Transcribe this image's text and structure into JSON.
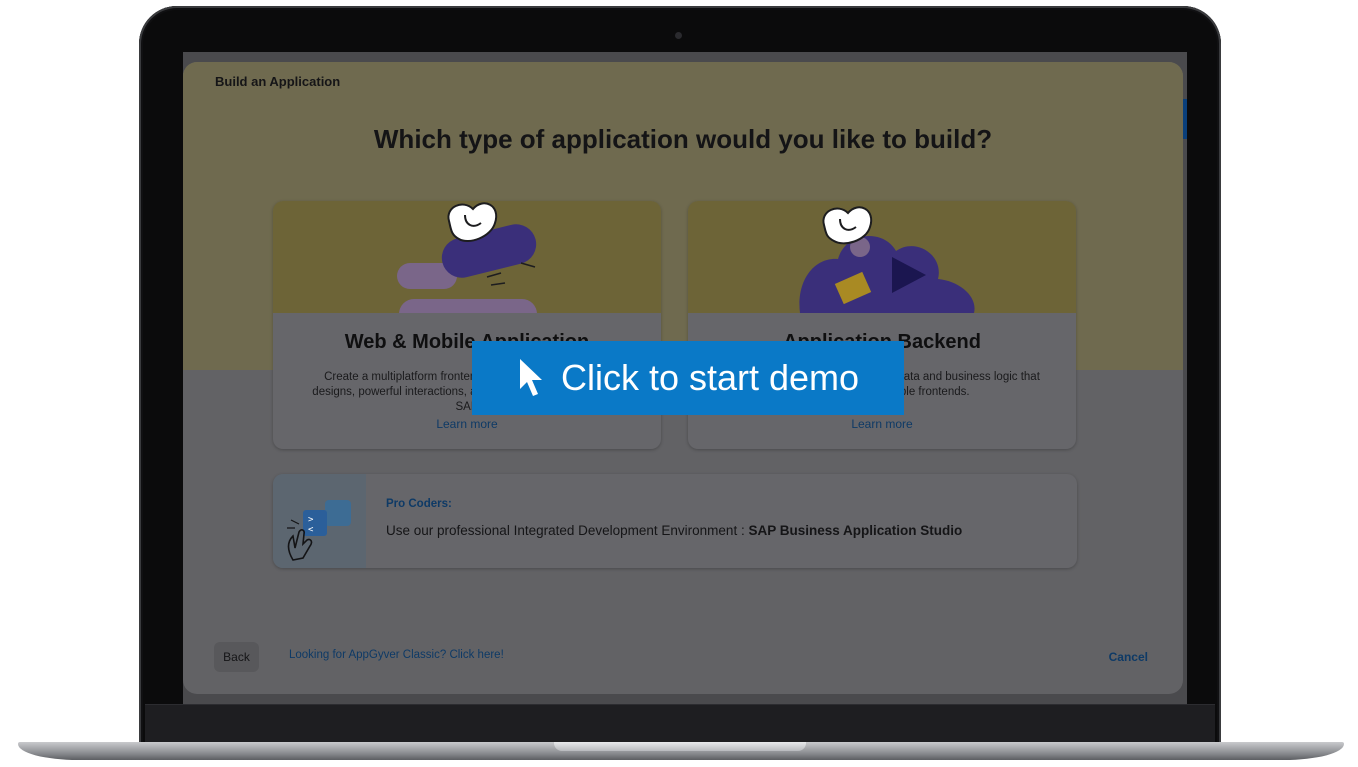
{
  "dialog": {
    "title": "Build an Application",
    "question": "Which type of application would you like to build?"
  },
  "cards": [
    {
      "title": "Web & Mobile Application",
      "description": "Create a multiplatform frontend with easy drag-and-drop designs, powerful interactions, and seamless integration with SAP",
      "link": "Learn more"
    },
    {
      "title": "Application Backend",
      "description": "Build an application backend with data and business logic that can be used by multiple frontends.",
      "link": "Learn more"
    }
  ],
  "pro": {
    "label": "Pro Coders:",
    "text": "Use our professional Integrated Development Environment : ",
    "product": "SAP Business Application Studio"
  },
  "footer": {
    "back": "Back",
    "classic_link": "Looking for AppGyver Classic? Click here!",
    "cancel": "Cancel"
  },
  "overlay": {
    "label": "Click to start demo",
    "color": "#0a79c7"
  }
}
